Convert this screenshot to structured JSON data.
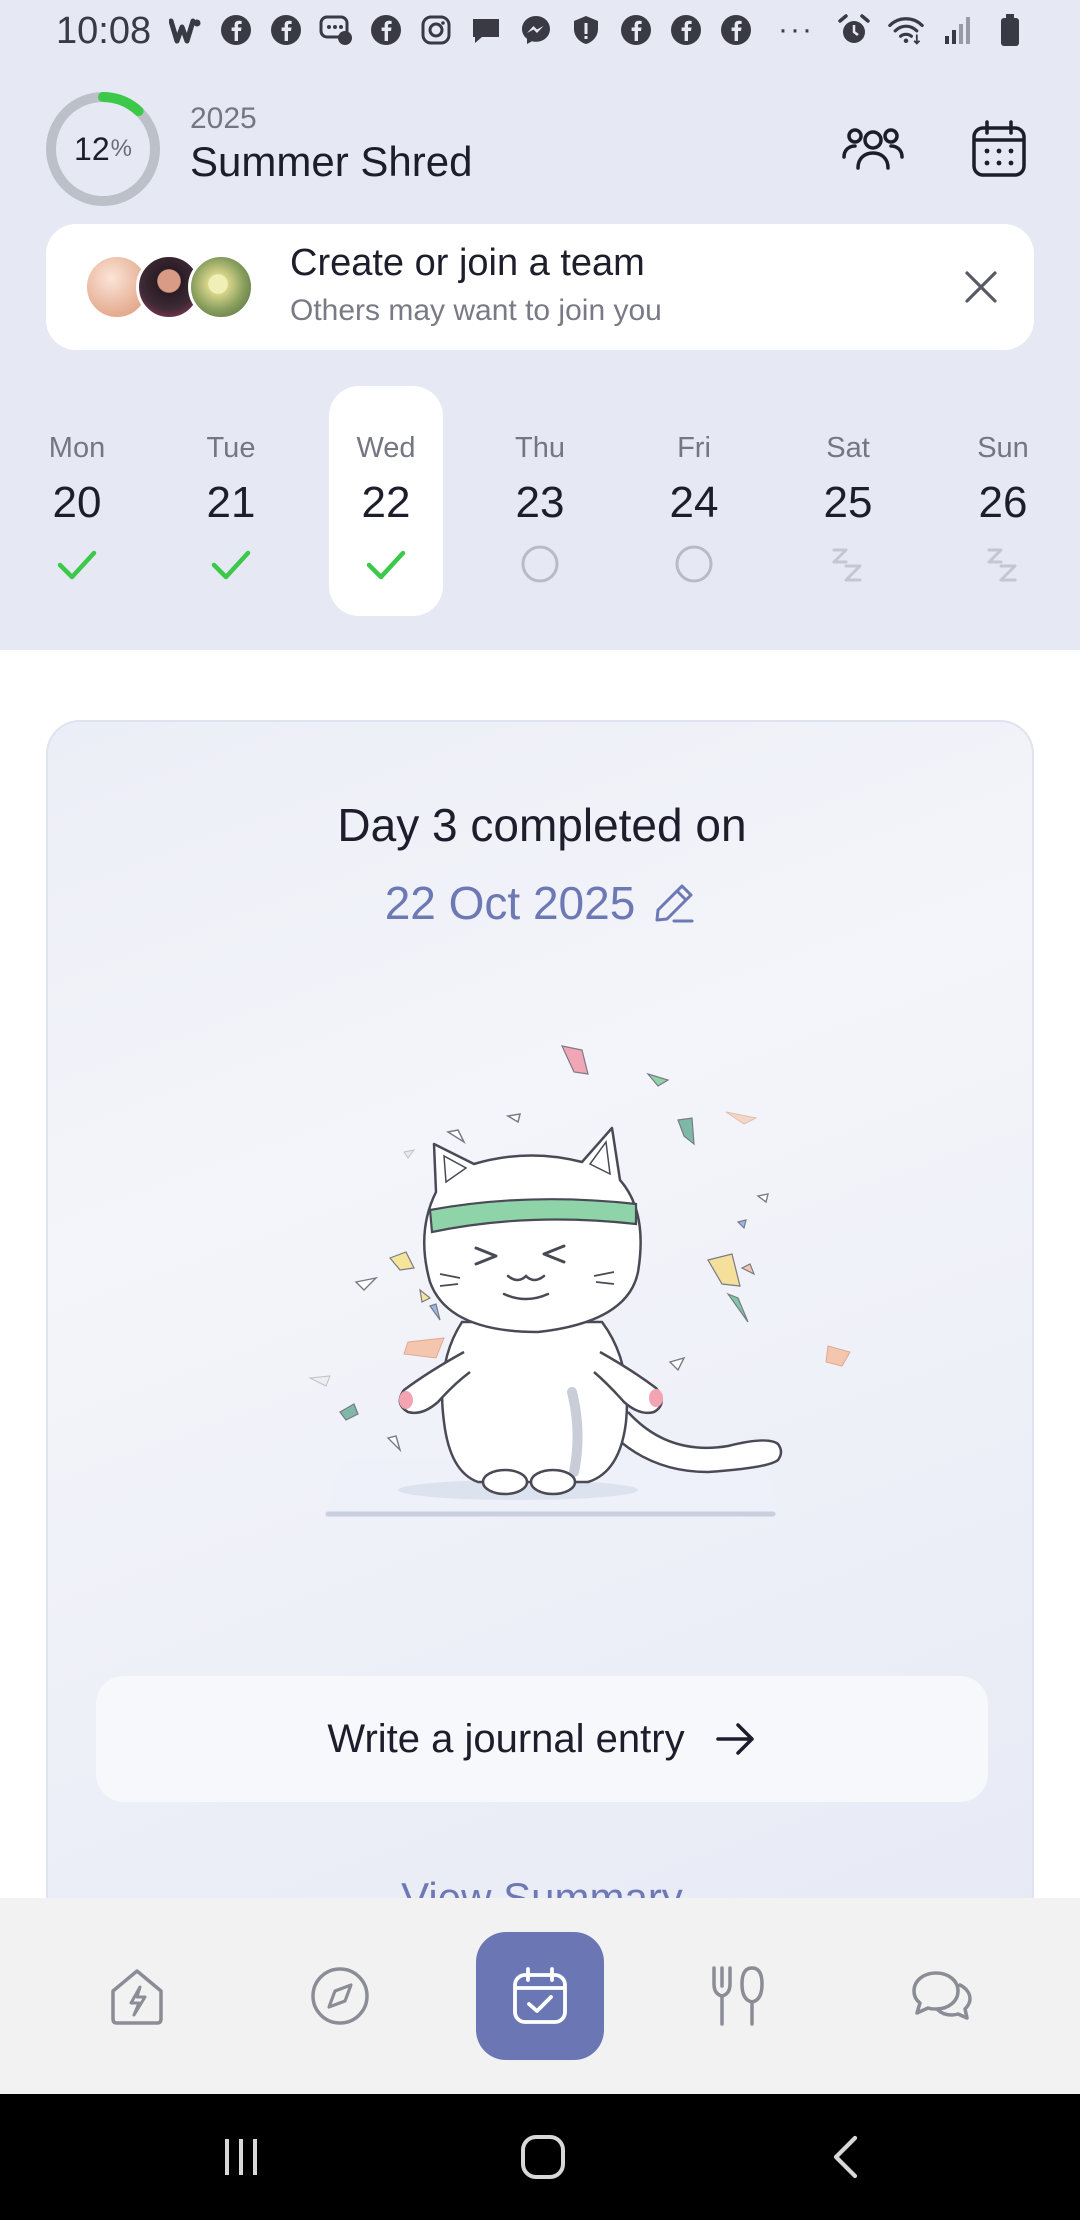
{
  "status_bar": {
    "time": "10:08",
    "left_icons": [
      "wattpad-icon",
      "facebook-icon",
      "facebook-icon",
      "messenger-chat-icon",
      "facebook-icon",
      "instagram-icon",
      "message-icon",
      "messenger-icon",
      "shield-alert-icon",
      "facebook-icon",
      "facebook-icon",
      "facebook-icon"
    ],
    "more": "···",
    "right_icons": [
      "alarm-icon",
      "wifi-icon",
      "signal-icon",
      "battery-icon"
    ]
  },
  "header": {
    "progress_value": "12",
    "progress_unit": "%",
    "progress_fraction": 0.12,
    "year": "2025",
    "title": "Summer Shred",
    "accent_color": "#3cc94a"
  },
  "team_card": {
    "title": "Create or join a team",
    "subtitle": "Others may want to join you"
  },
  "week": [
    {
      "name": "Mon",
      "num": "20",
      "status": "done"
    },
    {
      "name": "Tue",
      "num": "21",
      "status": "done"
    },
    {
      "name": "Wed",
      "num": "22",
      "status": "done",
      "selected": true
    },
    {
      "name": "Thu",
      "num": "23",
      "status": "pending"
    },
    {
      "name": "Fri",
      "num": "24",
      "status": "pending"
    },
    {
      "name": "Sat",
      "num": "25",
      "status": "rest"
    },
    {
      "name": "Sun",
      "num": "26",
      "status": "rest"
    }
  ],
  "main": {
    "completed_text": "Day 3 completed on",
    "date": "22 Oct 2025",
    "journal_button": "Write a journal entry",
    "view_summary": "View Summary"
  },
  "bottom_nav": {
    "items": [
      "home-bolt-icon",
      "compass-icon",
      "calendar-check-icon",
      "utensils-icon",
      "chat-icon"
    ],
    "active": "calendar-check-icon",
    "active_color": "#6b77b5"
  },
  "system_nav": [
    "recents-icon",
    "home-icon",
    "back-icon"
  ]
}
